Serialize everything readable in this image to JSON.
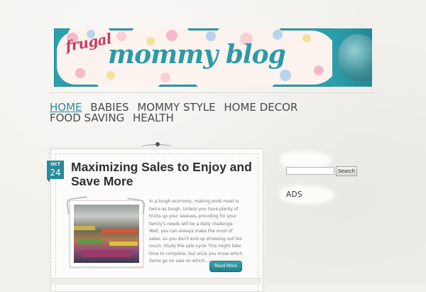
{
  "header": {
    "logo_small": "frugal",
    "logo_main": "mommy blog"
  },
  "nav": {
    "items": [
      {
        "label": "HOME",
        "active": true
      },
      {
        "label": "BABIES",
        "active": false
      },
      {
        "label": "MOMMY STYLE",
        "active": false
      },
      {
        "label": "HOME DECOR",
        "active": false
      },
      {
        "label": "FOOD SAVING",
        "active": false
      },
      {
        "label": "HEALTH",
        "active": false
      }
    ]
  },
  "post": {
    "date_month": "OCT",
    "date_day": "24",
    "title": "Maximizing Sales to Enjoy and Save More",
    "excerpt": "In a tough economy, making ends meet is twice as tough. Unless you have plenty of tricks up your sleeves, providing for your family's needs will be a daily challenge. Well, you can always make the most of sales, so you don't end up stressing out too much. Study the sale cycle This might take time to complete, but once you know which items go on sale on which...",
    "read_more": "Read More"
  },
  "sidebar": {
    "search_button": "Search",
    "search_value": "",
    "ads_heading": "ADS"
  },
  "colors": {
    "accent": "#2b8a98",
    "banner": "#2b9fad",
    "logo_pink": "#cc3a63",
    "background": "#f1f0ec"
  }
}
